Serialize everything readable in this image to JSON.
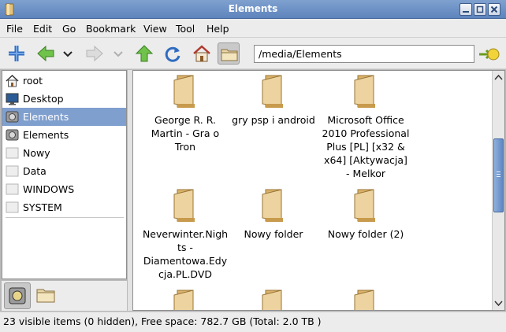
{
  "window": {
    "title": "Elements"
  },
  "menu": [
    {
      "label": "File"
    },
    {
      "label": "Edit"
    },
    {
      "label": "Go"
    },
    {
      "label": "Bookmark"
    },
    {
      "label": "View"
    },
    {
      "label": "Tool"
    },
    {
      "label": "Help"
    }
  ],
  "toolbar": {
    "icons": [
      "new-tab-icon",
      "back-icon",
      "history-dropdown-icon",
      "forward-icon",
      "forward-history-dropdown-icon",
      "up-icon",
      "reload-icon",
      "home-icon",
      "toggle-sidepane-icon",
      "go-icon"
    ],
    "path_value": "/media/Elements"
  },
  "sidepane": {
    "items": [
      {
        "label": "root",
        "icon": "home-icon"
      },
      {
        "label": "Desktop",
        "icon": "desktop-icon"
      },
      {
        "label": "Elements",
        "icon": "drive-icon",
        "selected": true
      },
      {
        "label": "Elements",
        "icon": "drive-icon"
      },
      {
        "label": "Nowy",
        "icon": "volume-icon"
      },
      {
        "label": "Data",
        "icon": "volume-icon"
      },
      {
        "label": "WINDOWS",
        "icon": "volume-icon"
      },
      {
        "label": "SYSTEM",
        "icon": "volume-icon"
      }
    ],
    "tabs": [
      "places-tab-icon",
      "dir-tree-tab-icon"
    ]
  },
  "files": [
    {
      "name": "George R. R. Martin - Gra o Tron"
    },
    {
      "name": "gry psp i android"
    },
    {
      "name": "Microsoft Office 2010 Professional Plus [PL] [x32 & x64] [Aktywacja] - Melkor"
    },
    {
      "name": "Neverwinter.Nights - Diamentowa.Edycja.PL.DVD"
    },
    {
      "name": "Nowy folder"
    },
    {
      "name": "Nowy folder (2)"
    },
    {
      "name": ""
    },
    {
      "name": ""
    },
    {
      "name": ""
    }
  ],
  "colors": {
    "selection": "#7f9fcf",
    "titlebar": "#6a8dc4",
    "folder": "#e8c98a"
  },
  "status": {
    "text": "23 visible items (0 hidden), Free space: 782.7 GB (Total: 2.0 TB )"
  }
}
